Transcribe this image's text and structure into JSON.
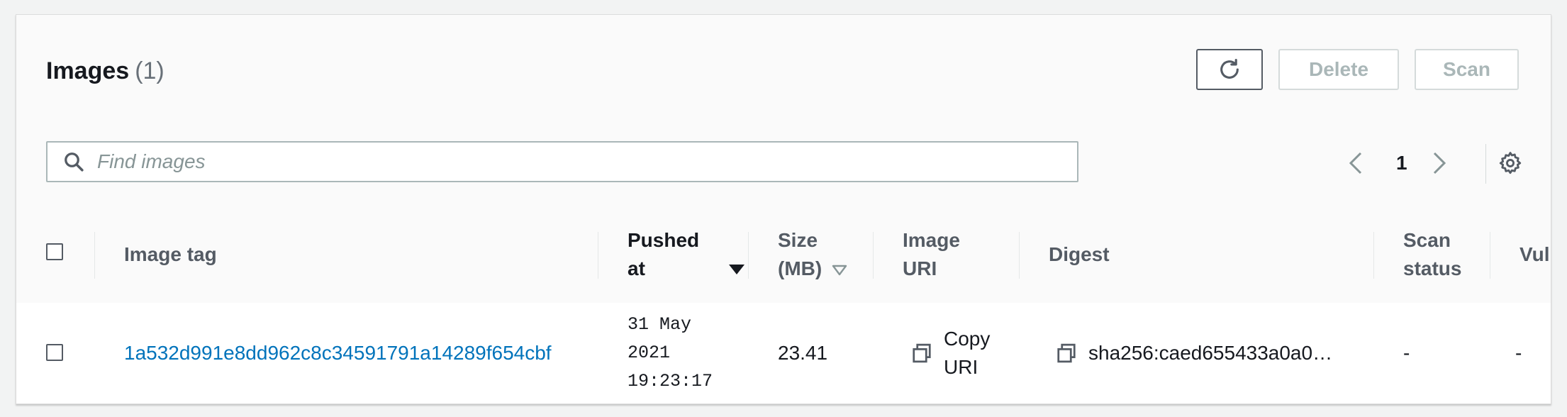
{
  "images_panel": {
    "title": "Images",
    "count": "(1)",
    "buttons": {
      "refresh_icon": "refresh-icon",
      "delete": "Delete",
      "scan": "Scan"
    },
    "search": {
      "placeholder": "Find images",
      "value": ""
    },
    "pagination": {
      "current_page": "1"
    }
  },
  "table": {
    "columns": [
      {
        "key": "image_tag",
        "label": "Image tag"
      },
      {
        "key": "pushed_at",
        "label_line1": "Pushed",
        "label_line2": "at",
        "sort": "descending"
      },
      {
        "key": "size",
        "label_line1": "Size",
        "label_line2": "(MB)",
        "sort": "sortable"
      },
      {
        "key": "image_uri",
        "label_line1": "Image",
        "label_line2": "URI"
      },
      {
        "key": "digest",
        "label": "Digest"
      },
      {
        "key": "scan_status",
        "label_line1": "Scan",
        "label_line2": "status"
      },
      {
        "key": "vulnerabilities",
        "label": "Vul"
      }
    ],
    "rows": [
      {
        "image_tag": "1a532d991e8dd962c8c34591791a14289f654cbf",
        "pushed_at_line1": "31 May",
        "pushed_at_line2": "2021",
        "pushed_at_line3": "19:23:17",
        "size": "23.41",
        "image_uri_line1": "Copy",
        "image_uri_line2": "URI",
        "digest": "sha256:caed655433a0a0…",
        "scan_status": "-",
        "vulnerabilities": "-"
      }
    ]
  },
  "colors": {
    "link": "#0073bb",
    "text": "#16191f",
    "muted": "#687078",
    "disabled": "#aab7b8"
  }
}
